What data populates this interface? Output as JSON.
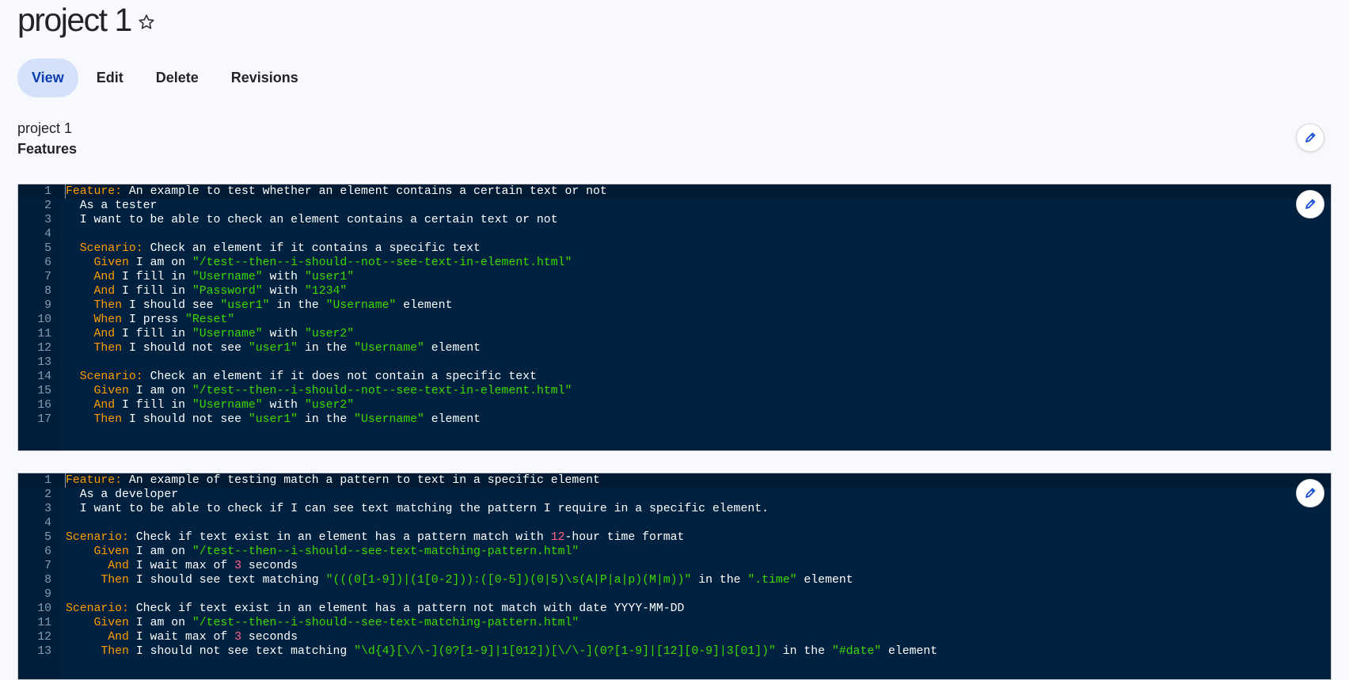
{
  "page": {
    "title": "project 1",
    "favorite_icon": "star-outline-icon",
    "tabs": [
      {
        "label": "View",
        "active": true
      },
      {
        "label": "Edit",
        "active": false
      },
      {
        "label": "Delete",
        "active": false
      },
      {
        "label": "Revisions",
        "active": false
      }
    ],
    "subtitle": "project 1",
    "section_label": "Features",
    "edit_icon": "pencil-icon"
  },
  "colors": {
    "keyword": "#ff9d00",
    "string": "#3ad900",
    "number": "#ff628c",
    "code_bg": "#002240",
    "accent": "#0b3cb0"
  },
  "features": [
    {
      "lines": [
        [
          [
            "kw",
            "Feature:"
          ],
          [
            "t",
            " An example to test whether an element contains a certain text or not"
          ]
        ],
        [
          [
            "t",
            "  As a tester"
          ]
        ],
        [
          [
            "t",
            "  I want to be able to check an element contains a certain text or not"
          ]
        ],
        [],
        [
          [
            "t",
            "  "
          ],
          [
            "kw",
            "Scenario:"
          ],
          [
            "t",
            " Check an element if it contains a specific text"
          ]
        ],
        [
          [
            "t",
            "    "
          ],
          [
            "kw",
            "Given"
          ],
          [
            "t",
            " I am on "
          ],
          [
            "str",
            "\"/test--then--i-should--not--see-text-in-element.html\""
          ]
        ],
        [
          [
            "t",
            "    "
          ],
          [
            "kw",
            "And"
          ],
          [
            "t",
            " I fill in "
          ],
          [
            "str",
            "\"Username\""
          ],
          [
            "t",
            " with "
          ],
          [
            "str",
            "\"user1\""
          ]
        ],
        [
          [
            "t",
            "    "
          ],
          [
            "kw",
            "And"
          ],
          [
            "t",
            " I fill in "
          ],
          [
            "str",
            "\"Password\""
          ],
          [
            "t",
            " with "
          ],
          [
            "str",
            "\"1234\""
          ]
        ],
        [
          [
            "t",
            "    "
          ],
          [
            "kw",
            "Then"
          ],
          [
            "t",
            " I should see "
          ],
          [
            "str",
            "\"user1\""
          ],
          [
            "t",
            " in the "
          ],
          [
            "str",
            "\"Username\""
          ],
          [
            "t",
            " element"
          ]
        ],
        [
          [
            "t",
            "    "
          ],
          [
            "kw",
            "When"
          ],
          [
            "t",
            " I press "
          ],
          [
            "str",
            "\"Reset\""
          ]
        ],
        [
          [
            "t",
            "    "
          ],
          [
            "kw",
            "And"
          ],
          [
            "t",
            " I fill in "
          ],
          [
            "str",
            "\"Username\""
          ],
          [
            "t",
            " with "
          ],
          [
            "str",
            "\"user2\""
          ]
        ],
        [
          [
            "t",
            "    "
          ],
          [
            "kw",
            "Then"
          ],
          [
            "t",
            " I should not see "
          ],
          [
            "str",
            "\"user1\""
          ],
          [
            "t",
            " in the "
          ],
          [
            "str",
            "\"Username\""
          ],
          [
            "t",
            " element"
          ]
        ],
        [],
        [
          [
            "t",
            "  "
          ],
          [
            "kw",
            "Scenario:"
          ],
          [
            "t",
            " Check an element if it does not contain a specific text"
          ]
        ],
        [
          [
            "t",
            "    "
          ],
          [
            "kw",
            "Given"
          ],
          [
            "t",
            " I am on "
          ],
          [
            "str",
            "\"/test--then--i-should--not--see-text-in-element.html\""
          ]
        ],
        [
          [
            "t",
            "    "
          ],
          [
            "kw",
            "And"
          ],
          [
            "t",
            " I fill in "
          ],
          [
            "str",
            "\"Username\""
          ],
          [
            "t",
            " with "
          ],
          [
            "str",
            "\"user2\""
          ]
        ],
        [
          [
            "t",
            "    "
          ],
          [
            "kw",
            "Then"
          ],
          [
            "t",
            " I should not see "
          ],
          [
            "str",
            "\"user1\""
          ],
          [
            "t",
            " in the "
          ],
          [
            "str",
            "\"Username\""
          ],
          [
            "t",
            " element"
          ]
        ]
      ]
    },
    {
      "lines": [
        [
          [
            "kw",
            "Feature:"
          ],
          [
            "t",
            " An example of testing match a pattern to text in a specific element"
          ]
        ],
        [
          [
            "t",
            "  As a developer"
          ]
        ],
        [
          [
            "t",
            "  I want to be able to check if I can see text matching the pattern I require in a specific element."
          ]
        ],
        [],
        [
          [
            "kw",
            "Scenario:"
          ],
          [
            "t",
            " Check if text exist in an element has a pattern match with "
          ],
          [
            "num",
            "12"
          ],
          [
            "t",
            "-hour time format"
          ]
        ],
        [
          [
            "t",
            "    "
          ],
          [
            "kw",
            "Given"
          ],
          [
            "t",
            " I am on "
          ],
          [
            "str",
            "\"/test--then--i-should--see-text-matching-pattern.html\""
          ]
        ],
        [
          [
            "t",
            "      "
          ],
          [
            "kw",
            "And"
          ],
          [
            "t",
            " I wait max of "
          ],
          [
            "num",
            "3"
          ],
          [
            "t",
            " seconds"
          ]
        ],
        [
          [
            "t",
            "     "
          ],
          [
            "kw",
            "Then"
          ],
          [
            "t",
            " I should see text matching "
          ],
          [
            "str",
            "\"(((0[1-9])|(1[0-2])):([0-5])(0|5)\\s(A|P|a|p)(M|m))\""
          ],
          [
            "t",
            " in the "
          ],
          [
            "str",
            "\".time\""
          ],
          [
            "t",
            " element"
          ]
        ],
        [],
        [
          [
            "kw",
            "Scenario:"
          ],
          [
            "t",
            " Check if text exist in an element has a pattern not match with date YYYY-MM-DD"
          ]
        ],
        [
          [
            "t",
            "    "
          ],
          [
            "kw",
            "Given"
          ],
          [
            "t",
            " I am on "
          ],
          [
            "str",
            "\"/test--then--i-should--see-text-matching-pattern.html\""
          ]
        ],
        [
          [
            "t",
            "      "
          ],
          [
            "kw",
            "And"
          ],
          [
            "t",
            " I wait max of "
          ],
          [
            "num",
            "3"
          ],
          [
            "t",
            " seconds"
          ]
        ],
        [
          [
            "t",
            "     "
          ],
          [
            "kw",
            "Then"
          ],
          [
            "t",
            " I should not see text matching "
          ],
          [
            "str",
            "\"\\d{4}[\\/\\-](0?[1-9]|1[012])[\\/\\-](0?[1-9]|[12][0-9]|3[01])\""
          ],
          [
            "t",
            " in the "
          ],
          [
            "str",
            "\"#date\""
          ],
          [
            "t",
            " element"
          ]
        ]
      ]
    }
  ]
}
